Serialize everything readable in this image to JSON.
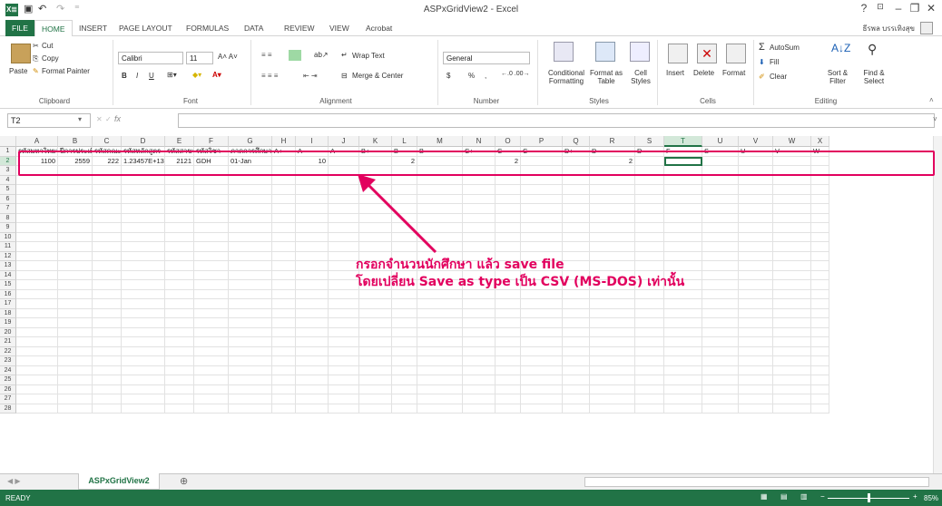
{
  "window": {
    "title": "ASPxGridView2 - Excel",
    "help": "?",
    "minimize": "–",
    "restore": "❐",
    "close": "✕",
    "logo": "X≣"
  },
  "tabs": [
    "FILE",
    "HOME",
    "INSERT",
    "PAGE LAYOUT",
    "FORMULAS",
    "DATA",
    "REVIEW",
    "VIEW",
    "Acrobat"
  ],
  "user": "ธีรพล บรรเทิงสุข",
  "ribbon": {
    "clipboard": {
      "paste": "Paste",
      "cut": "Cut",
      "copy": "Copy",
      "format_painter": "Format Painter",
      "label": "Clipboard"
    },
    "font": {
      "name": "Calibri",
      "size": "11",
      "label": "Font",
      "bold": "B",
      "italic": "I",
      "underline": "U"
    },
    "alignment": {
      "wrap": "Wrap Text",
      "merge": "Merge & Center",
      "label": "Alignment"
    },
    "number": {
      "format": "General",
      "currency": "$",
      "percent": "%",
      "comma": ",",
      "label": "Number"
    },
    "styles": {
      "conditional": "Conditional Formatting",
      "format_table": "Format as Table",
      "cell_styles": "Cell Styles",
      "label": "Styles"
    },
    "cells": {
      "insert": "Insert",
      "delete": "Delete",
      "format": "Format",
      "label": "Cells"
    },
    "editing": {
      "autosum": "AutoSum",
      "fill": "Fill",
      "clear": "Clear",
      "sort": "Sort & Filter",
      "find": "Find & Select",
      "label": "Editing"
    }
  },
  "formula_bar": {
    "name_box": "T2",
    "fx": "fx",
    "value": ""
  },
  "columns": [
    "A",
    "B",
    "C",
    "D",
    "E",
    "F",
    "G",
    "H",
    "I",
    "J",
    "K",
    "L",
    "M",
    "N",
    "O",
    "P",
    "Q",
    "R",
    "S",
    "T",
    "U",
    "V",
    "W",
    "X"
  ],
  "header_row": [
    "รหัสมหาวิทยาลัย",
    "ปีการประเมิน",
    "รหัสคณะ",
    "รหัสหลักสูตร",
    "รหัสสาขา",
    "รหัสวิชา",
    "ภาคการศึกษา",
    "A+",
    "A",
    "A-",
    "B+",
    "B",
    "B-",
    "C+",
    "C",
    "C-",
    "D+",
    "D",
    "D-",
    "F",
    "S",
    "U",
    "V",
    "W"
  ],
  "data_row": [
    "1100",
    "2559",
    "222",
    "1.23457E+13",
    "2121",
    "GDH",
    "01-Jan",
    "",
    "10",
    "",
    "",
    "2",
    "",
    "",
    "2",
    "",
    "",
    "2",
    "",
    "",
    "",
    "",
    "",
    ""
  ],
  "row_numbers": [
    "1",
    "2",
    "3",
    "4",
    "5",
    "6",
    "7",
    "8",
    "9",
    "10",
    "11",
    "12",
    "13",
    "14",
    "15",
    "16",
    "17",
    "18",
    "19",
    "20",
    "21",
    "22",
    "23",
    "24",
    "25",
    "26",
    "27",
    "28"
  ],
  "annotation": {
    "line1": "กรอกจำนวนนักศึกษา แล้ว save file",
    "line2": "โดยเปลี่ยน Save as type เป็น CSV (MS-DOS) เท่านั้น"
  },
  "sheet_tab": "ASPxGridView2",
  "add_sheet": "⊕",
  "status": {
    "ready": "READY",
    "zoom": "85%"
  },
  "colors": {
    "excel_green": "#217346",
    "annotation": "#e2005e"
  }
}
